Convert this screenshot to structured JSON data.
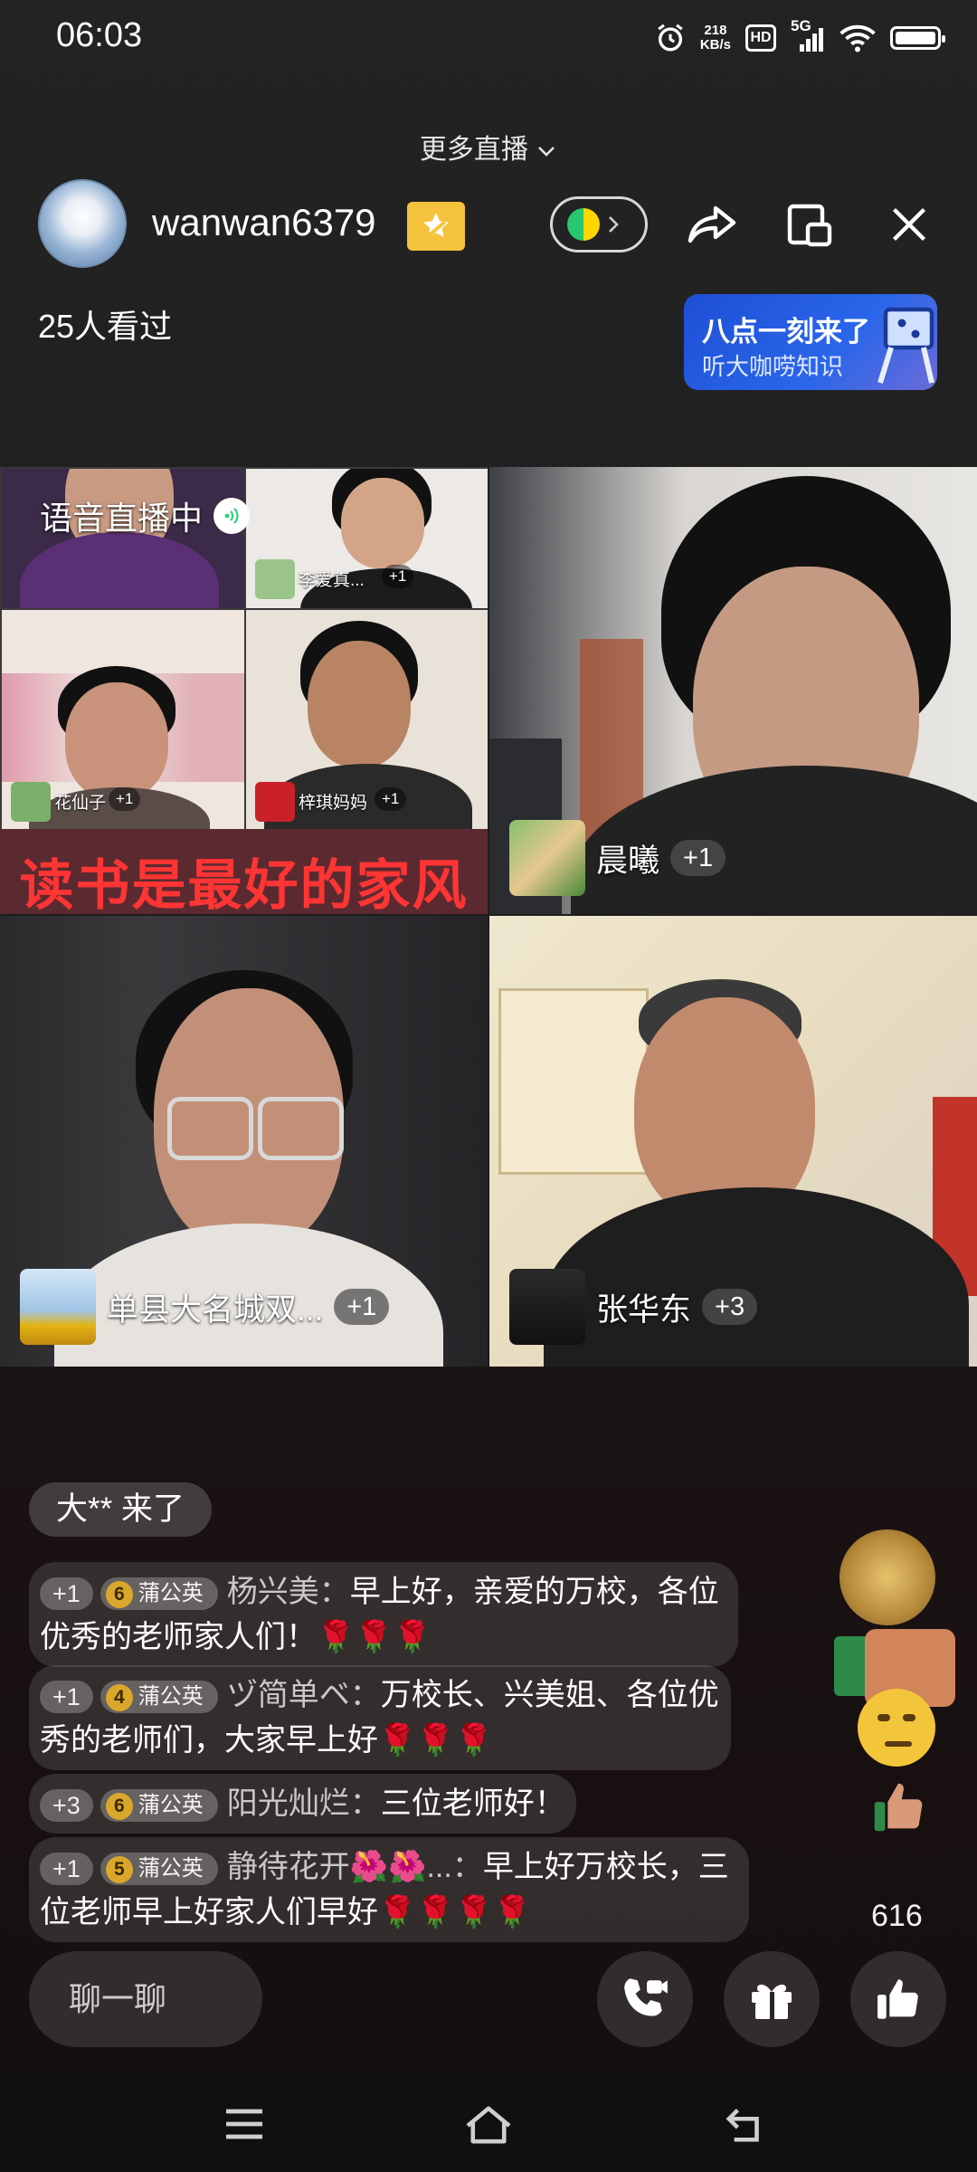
{
  "status": {
    "time": "06:03",
    "net_speed_value": "218",
    "net_speed_unit": "KB/s",
    "hd": "HD",
    "network": "5G",
    "battery_level": 0.85
  },
  "header": {
    "more_live": "更多直播",
    "username": "wanwan6379",
    "viewers": "25人看过",
    "promo_title": "八点一刻来了",
    "promo_sub": "听大咖唠知识"
  },
  "grid": {
    "voice_label": "语音直播中",
    "banner": "读书是最好的家风",
    "sub_tiles": [
      {
        "name": "李爱真...",
        "plus": "+1"
      },
      {
        "name": "花仙子",
        "plus": "+1"
      },
      {
        "name": "梓琪妈妈",
        "plus": "+1"
      }
    ],
    "tiles": [
      {
        "name": "晨曦",
        "plus": "+1"
      },
      {
        "name": "单县大名城双...",
        "plus": "+1"
      },
      {
        "name": "张华东",
        "plus": "+3"
      }
    ]
  },
  "chat": {
    "join_notice": "大** 来了",
    "messages": [
      {
        "lv": "+1",
        "fan_num": "6",
        "fan": "蒲公英",
        "sender": "杨兴美：",
        "text": "早上好，亲爱的万校，各位优秀的老师家人们！",
        "flowers": "🌹🌹🌹"
      },
      {
        "lv": "+1",
        "fan_num": "4",
        "fan": "蒲公英",
        "sender": "ヅ简单ベ：",
        "text": "万校长、兴美姐、各位优秀的老师们，大家早上好",
        "flowers": "🌹🌹🌹"
      },
      {
        "lv": "+3",
        "fan_num": "6",
        "fan": "蒲公英",
        "sender": "阳光灿烂：",
        "text": "三位老师好！",
        "flowers": ""
      },
      {
        "lv": "+1",
        "fan_num": "5",
        "fan": "蒲公英",
        "sender": "静待花开🌺🌺...：",
        "text": "早上好万校长，三位老师早上好家人们早好",
        "flowers": "🌹🌹🌹🌹"
      }
    ]
  },
  "likes": "616",
  "bottom": {
    "chat_placeholder": "聊一聊"
  }
}
